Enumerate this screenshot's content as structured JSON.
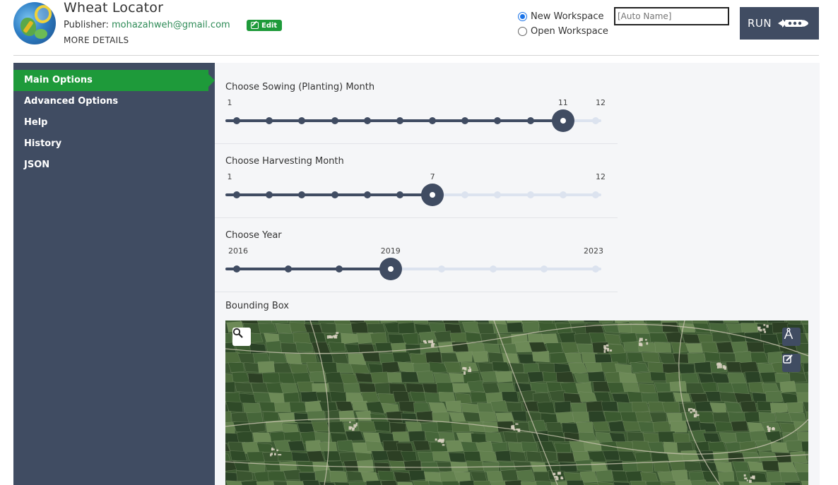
{
  "header": {
    "app_title": "Wheat Locator",
    "publisher_prefix": "Publisher: ",
    "publisher_email": "mohazahweh@gmail.com",
    "edit_label": "Edit",
    "more_details": "MORE DETAILS",
    "workspace": {
      "new_label": "New Workspace",
      "open_label": "Open Workspace",
      "selected": "new",
      "name_placeholder": "[Auto Name]"
    },
    "run_label": "RUN"
  },
  "sidebar": {
    "items": [
      {
        "label": "Main Options",
        "active": true
      },
      {
        "label": "Advanced Options",
        "active": false
      },
      {
        "label": "Help",
        "active": false
      },
      {
        "label": "History",
        "active": false
      },
      {
        "label": "JSON",
        "active": false
      }
    ]
  },
  "options": {
    "sowing": {
      "label": "Choose Sowing (Planting) Month",
      "min": 1,
      "max": 12,
      "value": 11,
      "min_label": "1",
      "max_label": "12",
      "value_label": "11"
    },
    "harvest": {
      "label": "Choose Harvesting Month",
      "min": 1,
      "max": 12,
      "value": 7,
      "min_label": "1",
      "max_label": "12",
      "value_label": "7"
    },
    "year": {
      "label": "Choose Year",
      "min": 2016,
      "max": 2023,
      "value": 2019,
      "min_label": "2016",
      "max_label": "2023",
      "value_label": "2019"
    },
    "bbox_label": "Bounding Box"
  },
  "map": {
    "search_icon": "search-icon",
    "draw_icon": "compass-draw-icon",
    "edit_icon": "edit-icon"
  },
  "colors": {
    "accent_green": "#1e9a3a",
    "sidebar_bg": "#404c62",
    "track_light": "#dce3ef"
  }
}
